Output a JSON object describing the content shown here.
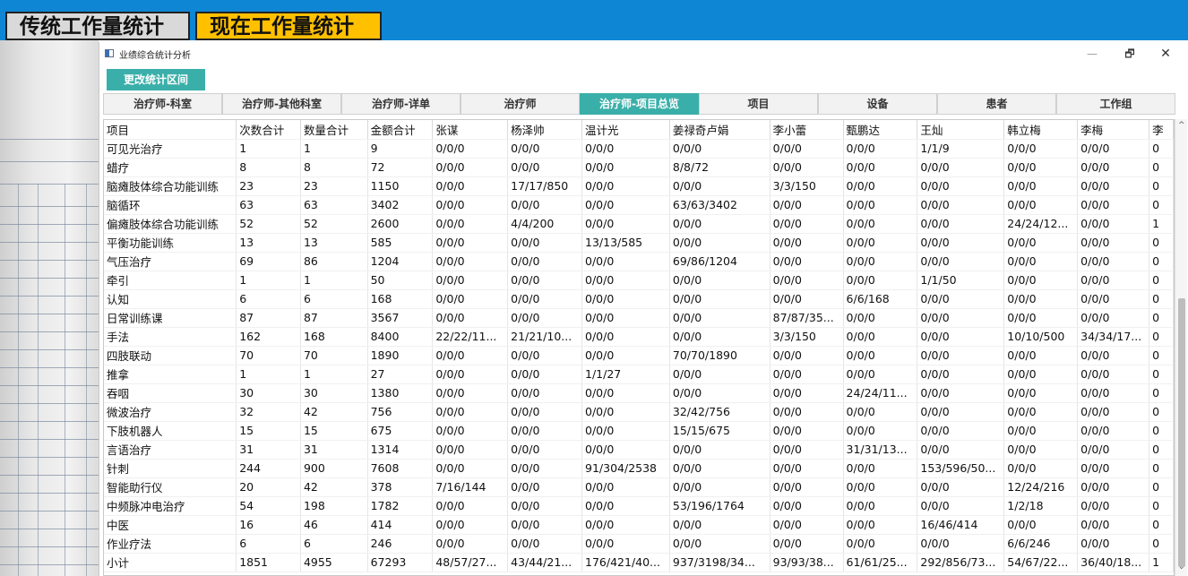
{
  "banner": {
    "traditional_label": "传统工作量统计",
    "current_label": "现在工作量统计"
  },
  "window": {
    "title": "业绩综合统计分析",
    "minimize": "—",
    "maximize": "🗗",
    "close": "✕"
  },
  "toolbar": {
    "change_range_label": "更改统计区间"
  },
  "tabs": [
    {
      "label": "治疗师-科室",
      "active": false
    },
    {
      "label": "治疗师-其他科室",
      "active": false
    },
    {
      "label": "治疗师-详单",
      "active": false
    },
    {
      "label": "治疗师",
      "active": false
    },
    {
      "label": "治疗师-项目总览",
      "active": true
    },
    {
      "label": "项目",
      "active": false
    },
    {
      "label": "设备",
      "active": false
    },
    {
      "label": "患者",
      "active": false
    },
    {
      "label": "工作组",
      "active": false
    }
  ],
  "table": {
    "columns": [
      "项目",
      "次数合计",
      "数量合计",
      "金额合计",
      "张谋",
      "杨泽帅",
      "温计光",
      "姜禄奇卢娟",
      "李小蕾",
      "甄鹏达",
      "王灿",
      "韩立梅",
      "李梅",
      "李"
    ],
    "rows": [
      [
        "可见光治疗",
        "1",
        "1",
        "9",
        "0/0/0",
        "0/0/0",
        "0/0/0",
        "0/0/0",
        "0/0/0",
        "0/0/0",
        "1/1/9",
        "0/0/0",
        "0/0/0",
        "0"
      ],
      [
        "蜡疗",
        "8",
        "8",
        "72",
        "0/0/0",
        "0/0/0",
        "0/0/0",
        "8/8/72",
        "0/0/0",
        "0/0/0",
        "0/0/0",
        "0/0/0",
        "0/0/0",
        "0"
      ],
      [
        "脑瘫肢体综合功能训练",
        "23",
        "23",
        "1150",
        "0/0/0",
        "17/17/850",
        "0/0/0",
        "0/0/0",
        "3/3/150",
        "0/0/0",
        "0/0/0",
        "0/0/0",
        "0/0/0",
        "0"
      ],
      [
        "脑循环",
        "63",
        "63",
        "3402",
        "0/0/0",
        "0/0/0",
        "0/0/0",
        "63/63/3402",
        "0/0/0",
        "0/0/0",
        "0/0/0",
        "0/0/0",
        "0/0/0",
        "0"
      ],
      [
        "偏瘫肢体综合功能训练",
        "52",
        "52",
        "2600",
        "0/0/0",
        "4/4/200",
        "0/0/0",
        "0/0/0",
        "0/0/0",
        "0/0/0",
        "0/0/0",
        "24/24/12...",
        "0/0/0",
        "1"
      ],
      [
        "平衡功能训练",
        "13",
        "13",
        "585",
        "0/0/0",
        "0/0/0",
        "13/13/585",
        "0/0/0",
        "0/0/0",
        "0/0/0",
        "0/0/0",
        "0/0/0",
        "0/0/0",
        "0"
      ],
      [
        "气压治疗",
        "69",
        "86",
        "1204",
        "0/0/0",
        "0/0/0",
        "0/0/0",
        "69/86/1204",
        "0/0/0",
        "0/0/0",
        "0/0/0",
        "0/0/0",
        "0/0/0",
        "0"
      ],
      [
        "牵引",
        "1",
        "1",
        "50",
        "0/0/0",
        "0/0/0",
        "0/0/0",
        "0/0/0",
        "0/0/0",
        "0/0/0",
        "1/1/50",
        "0/0/0",
        "0/0/0",
        "0"
      ],
      [
        "认知",
        "6",
        "6",
        "168",
        "0/0/0",
        "0/0/0",
        "0/0/0",
        "0/0/0",
        "0/0/0",
        "6/6/168",
        "0/0/0",
        "0/0/0",
        "0/0/0",
        "0"
      ],
      [
        "日常训练课",
        "87",
        "87",
        "3567",
        "0/0/0",
        "0/0/0",
        "0/0/0",
        "0/0/0",
        "87/87/35...",
        "0/0/0",
        "0/0/0",
        "0/0/0",
        "0/0/0",
        "0"
      ],
      [
        "手法",
        "162",
        "168",
        "8400",
        "22/22/11...",
        "21/21/10...",
        "0/0/0",
        "0/0/0",
        "3/3/150",
        "0/0/0",
        "0/0/0",
        "10/10/500",
        "34/34/17...",
        "0"
      ],
      [
        "四肢联动",
        "70",
        "70",
        "1890",
        "0/0/0",
        "0/0/0",
        "0/0/0",
        "70/70/1890",
        "0/0/0",
        "0/0/0",
        "0/0/0",
        "0/0/0",
        "0/0/0",
        "0"
      ],
      [
        "推拿",
        "1",
        "1",
        "27",
        "0/0/0",
        "0/0/0",
        "1/1/27",
        "0/0/0",
        "0/0/0",
        "0/0/0",
        "0/0/0",
        "0/0/0",
        "0/0/0",
        "0"
      ],
      [
        "吞咽",
        "30",
        "30",
        "1380",
        "0/0/0",
        "0/0/0",
        "0/0/0",
        "0/0/0",
        "0/0/0",
        "24/24/11...",
        "0/0/0",
        "0/0/0",
        "0/0/0",
        "0"
      ],
      [
        "微波治疗",
        "32",
        "42",
        "756",
        "0/0/0",
        "0/0/0",
        "0/0/0",
        "32/42/756",
        "0/0/0",
        "0/0/0",
        "0/0/0",
        "0/0/0",
        "0/0/0",
        "0"
      ],
      [
        "下肢机器人",
        "15",
        "15",
        "675",
        "0/0/0",
        "0/0/0",
        "0/0/0",
        "15/15/675",
        "0/0/0",
        "0/0/0",
        "0/0/0",
        "0/0/0",
        "0/0/0",
        "0"
      ],
      [
        "言语治疗",
        "31",
        "31",
        "1314",
        "0/0/0",
        "0/0/0",
        "0/0/0",
        "0/0/0",
        "0/0/0",
        "31/31/13...",
        "0/0/0",
        "0/0/0",
        "0/0/0",
        "0"
      ],
      [
        "针刺",
        "244",
        "900",
        "7608",
        "0/0/0",
        "0/0/0",
        "91/304/2538",
        "0/0/0",
        "0/0/0",
        "0/0/0",
        "153/596/50...",
        "0/0/0",
        "0/0/0",
        "0"
      ],
      [
        "智能助行仪",
        "20",
        "42",
        "378",
        "7/16/144",
        "0/0/0",
        "0/0/0",
        "0/0/0",
        "0/0/0",
        "0/0/0",
        "0/0/0",
        "12/24/216",
        "0/0/0",
        "0"
      ],
      [
        "中频脉冲电治疗",
        "54",
        "198",
        "1782",
        "0/0/0",
        "0/0/0",
        "0/0/0",
        "53/196/1764",
        "0/0/0",
        "0/0/0",
        "0/0/0",
        "1/2/18",
        "0/0/0",
        "0"
      ],
      [
        "中医",
        "16",
        "46",
        "414",
        "0/0/0",
        "0/0/0",
        "0/0/0",
        "0/0/0",
        "0/0/0",
        "0/0/0",
        "16/46/414",
        "0/0/0",
        "0/0/0",
        "0"
      ],
      [
        "作业疗法",
        "6",
        "6",
        "246",
        "0/0/0",
        "0/0/0",
        "0/0/0",
        "0/0/0",
        "0/0/0",
        "0/0/0",
        "0/0/0",
        "6/6/246",
        "0/0/0",
        "0"
      ],
      [
        "小计",
        "1851",
        "4955",
        "67293",
        "48/57/27...",
        "43/44/21...",
        "176/421/40...",
        "937/3198/34...",
        "93/93/38...",
        "61/61/25...",
        "292/856/73...",
        "54/67/22...",
        "36/40/18...",
        "1"
      ]
    ]
  },
  "scrollbar": {
    "up_arrow": "^",
    "down_arrow": "⌄"
  }
}
